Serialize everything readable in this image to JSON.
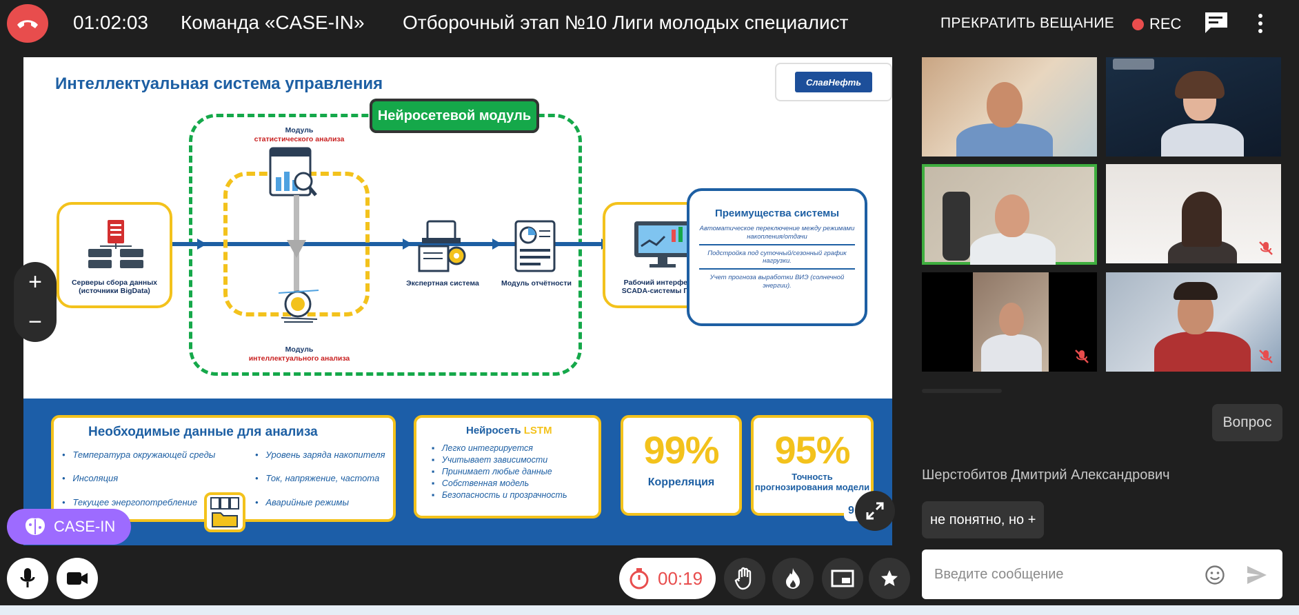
{
  "topbar": {
    "elapsed": "01:02:03",
    "team": "Команда «CASE-IN»",
    "event": "Отборочный этап №10 Лиги молодых специалист",
    "stop_broadcast": "ПРЕКРАТИТЬ ВЕЩАНИЕ",
    "rec": "REC"
  },
  "slide": {
    "title": "Интеллектуальная система управления",
    "logo_text": "СлавНефть",
    "nn_module": "Нейросетевой модуль",
    "servers": "Серверы сбора данных (источники BigData)",
    "stat_module_1": "Модуль",
    "stat_module_2": "статистического анализа",
    "intel_module_1": "Модуль",
    "intel_module_2": "интеллектуального анализа",
    "expert": "Экспертная система",
    "report": "Модуль отчётности",
    "scada": "Рабочий интерфейс SCADA-системы ГНЭ",
    "advantages_title": "Преимущества системы",
    "advantages": [
      "Автоматическое переключение между режимами накопления/отдачи",
      "Подстройка под суточный/сезонный график нагрузки.",
      "Учет прогноза выработки ВИЭ (солнечной энергии)."
    ],
    "data_title": "Необходимые данные для анализа",
    "data_left": [
      "Температура окружающей среды",
      "Инсоляция",
      "Текущее энергопотребление"
    ],
    "data_right": [
      "Уровень заряда накопителя",
      "Ток, напряжение, частота",
      "Аварийные режимы"
    ],
    "lstm_title_a": "Нейросеть ",
    "lstm_title_b": "LSTM",
    "lstm_items": [
      "Легко интегрируется",
      "Учитывает зависимости",
      "Принимает любые данные",
      "Собственная модель",
      "Безопасность и прозрачность"
    ],
    "corr_value": "99%",
    "corr_label": "Корреляция",
    "acc_value": "95%",
    "acc_label": "Точность прогнозирования модели",
    "page_num": "9"
  },
  "zoom": {
    "plus": "+",
    "minus": "−"
  },
  "badge": {
    "label": "CASE-IN"
  },
  "toolbar": {
    "timer": "00:19"
  },
  "chat": {
    "question": "Вопрос",
    "sender": "Шерстобитов Дмитрий Александрович",
    "message": "не понятно, но +",
    "placeholder": "Введите сообщение"
  },
  "colors": {
    "end_call": "#e84d4d",
    "accent_green": "#15a84a",
    "slide_blue": "#1d5fa3",
    "slide_yellow": "#f3c21c",
    "badge_purple": "#9d6bff"
  }
}
